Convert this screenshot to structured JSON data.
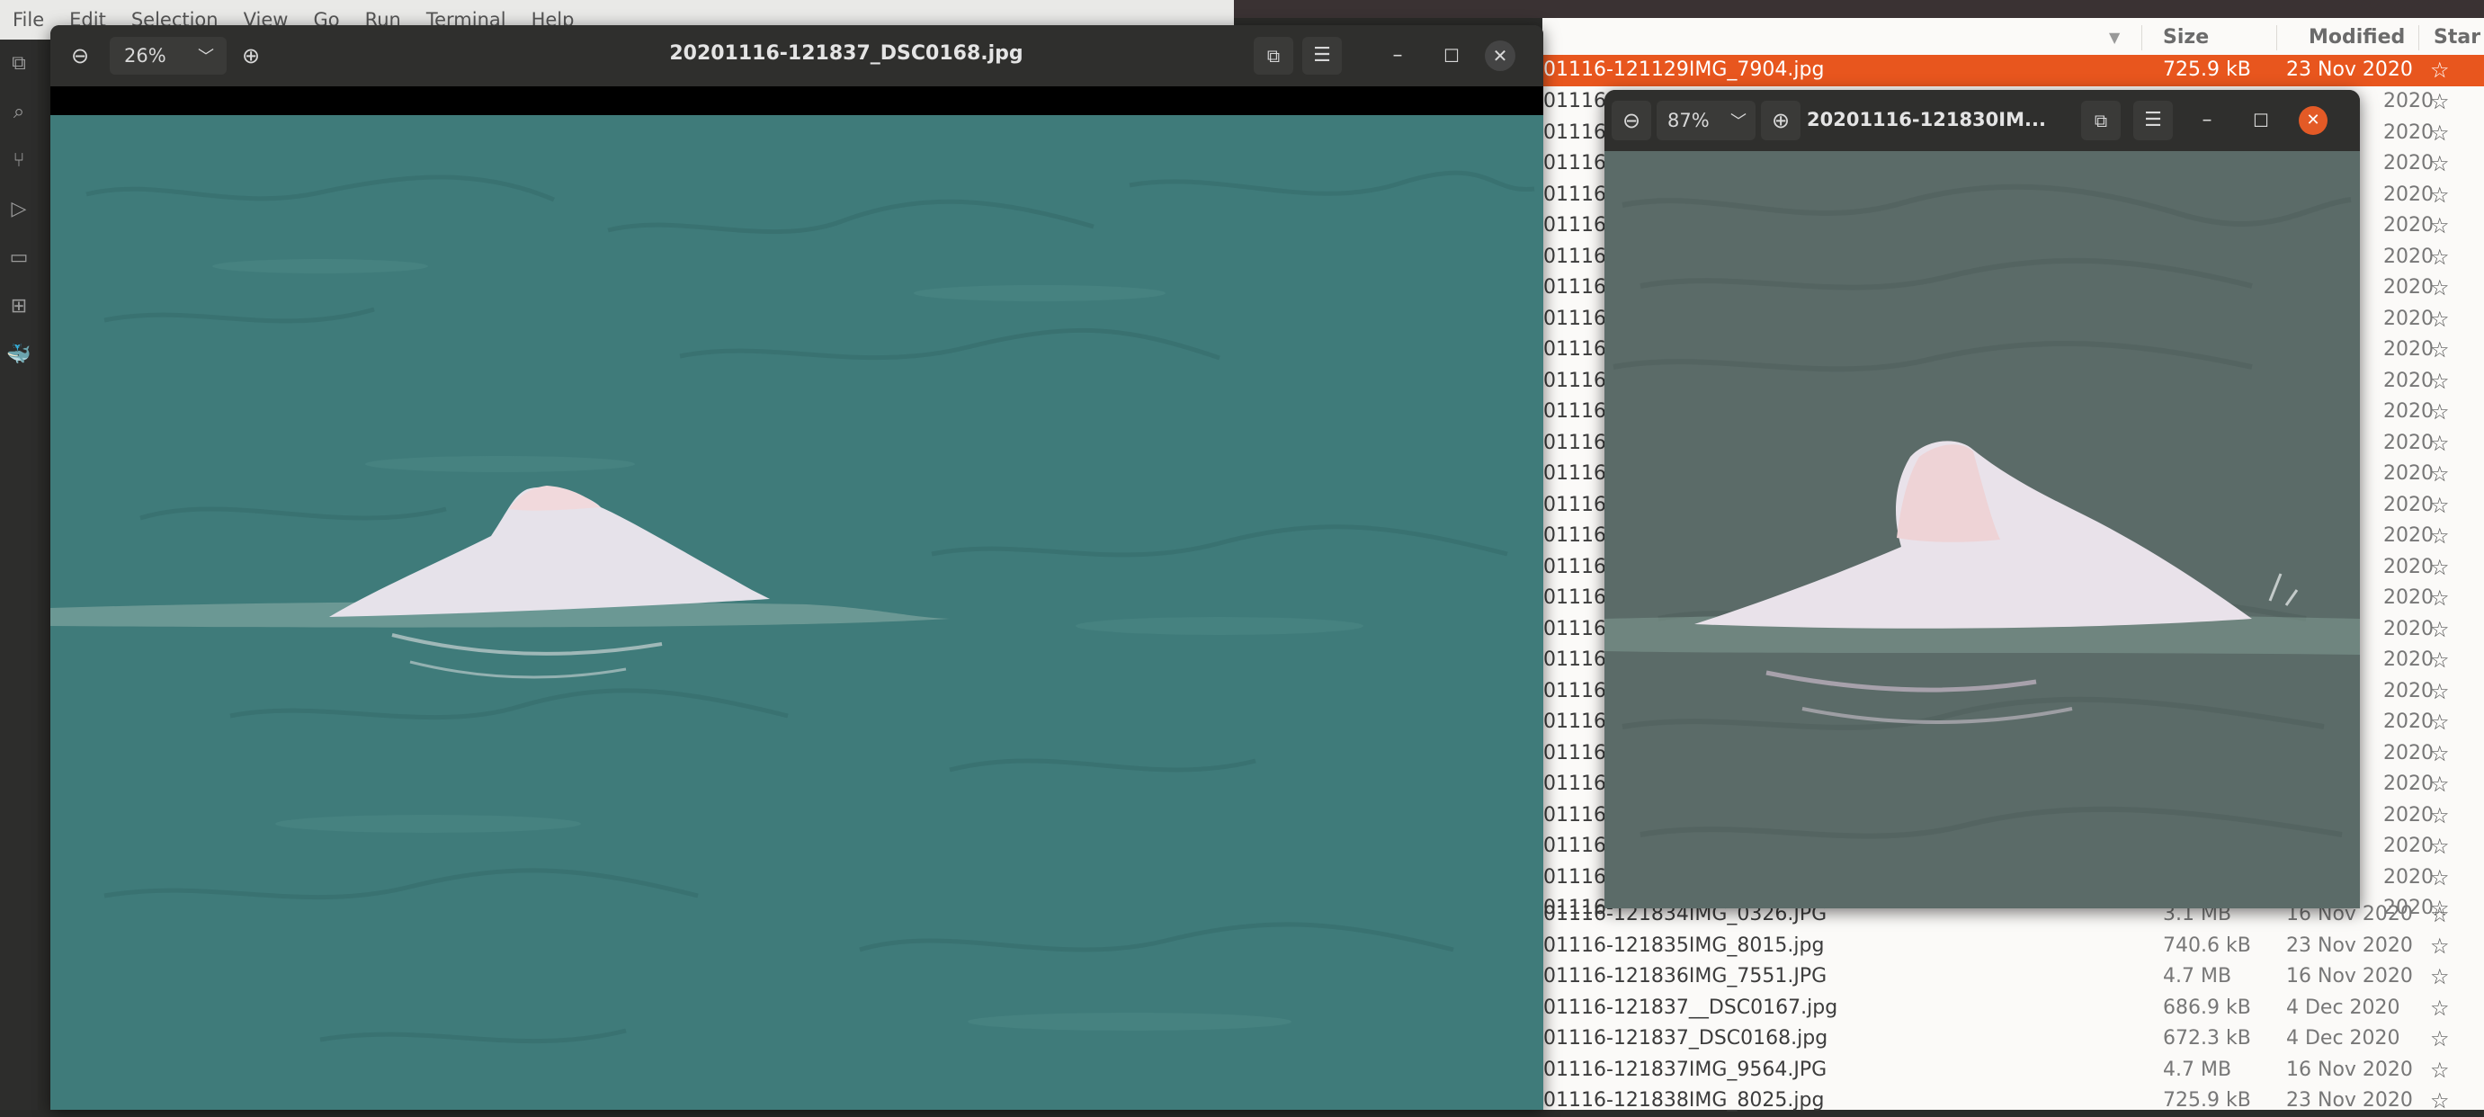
{
  "vscode": {
    "menu": [
      "File",
      "Edit",
      "Selection",
      "View",
      "Go",
      "Run",
      "Terminal",
      "Help"
    ]
  },
  "viewer_main": {
    "zoom": "26%",
    "title": "20201116-121837_DSC0168.jpg"
  },
  "viewer_second": {
    "zoom": "87%",
    "title": "20201116-121830IM..."
  },
  "file_manager": {
    "columns": {
      "size": "Size",
      "modified": "Modified",
      "star": "Star"
    },
    "selected_row": {
      "name": "01116-121129IMG_7904.jpg",
      "size": "725.9 kB",
      "modified": "23 Nov 2020"
    },
    "partial_rows": [
      {
        "name": "01116-",
        "modified": "2020"
      },
      {
        "name": "01116-",
        "modified": "2020"
      },
      {
        "name": "01116-",
        "modified": "2020"
      },
      {
        "name": "01116-",
        "modified": "2020"
      },
      {
        "name": "01116-",
        "modified": "2020"
      },
      {
        "name": "01116-",
        "modified": "2020"
      },
      {
        "name": "01116-",
        "modified": "2020"
      },
      {
        "name": "01116-",
        "modified": "2020"
      },
      {
        "name": "01116-",
        "modified": "2020"
      },
      {
        "name": "01116-",
        "modified": "2020"
      },
      {
        "name": "01116-",
        "modified": "2020"
      },
      {
        "name": "01116-",
        "modified": "2020"
      },
      {
        "name": "01116-",
        "modified": "2020"
      },
      {
        "name": "01116-",
        "modified": "2020"
      },
      {
        "name": "01116-",
        "modified": "2020"
      },
      {
        "name": "01116-",
        "modified": "2020"
      },
      {
        "name": "01116-",
        "modified": "2020"
      },
      {
        "name": "01116-",
        "modified": "2020"
      },
      {
        "name": "01116-",
        "modified": "2020"
      },
      {
        "name": "01116-",
        "modified": "2020"
      },
      {
        "name": "01116-",
        "modified": "2020"
      },
      {
        "name": "01116-",
        "modified": "2020"
      },
      {
        "name": "01116-",
        "modified": "2020"
      },
      {
        "name": "01116-",
        "modified": "2020"
      },
      {
        "name": "01116-",
        "modified": "2020"
      },
      {
        "name": "01116-",
        "modified": "2020"
      },
      {
        "name": "01116-",
        "modified": "2020"
      }
    ],
    "rows": [
      {
        "name": "01116-121834IMG_0326.JPG",
        "size": "3.1 MB",
        "modified": "16 Nov 2020"
      },
      {
        "name": "01116-121835IMG_8015.jpg",
        "size": "740.6 kB",
        "modified": "23 Nov 2020"
      },
      {
        "name": "01116-121836IMG_7551.JPG",
        "size": "4.7 MB",
        "modified": "16 Nov 2020"
      },
      {
        "name": "01116-121837__DSC0167.jpg",
        "size": "686.9 kB",
        "modified": "4 Dec 2020"
      },
      {
        "name": "01116-121837_DSC0168.jpg",
        "size": "672.3 kB",
        "modified": "4 Dec 2020"
      },
      {
        "name": "01116-121837IMG_9564.JPG",
        "size": "4.7 MB",
        "modified": "16 Nov 2020"
      },
      {
        "name": "01116-121838IMG_8025.jpg",
        "size": "725.9 kB",
        "modified": "23 Nov 2020"
      }
    ]
  },
  "colors": {
    "selection": "#e8561e",
    "water_main": "#3f7b7a",
    "water_second": "#5b6b68",
    "dolphin": "#e8e6ec"
  }
}
